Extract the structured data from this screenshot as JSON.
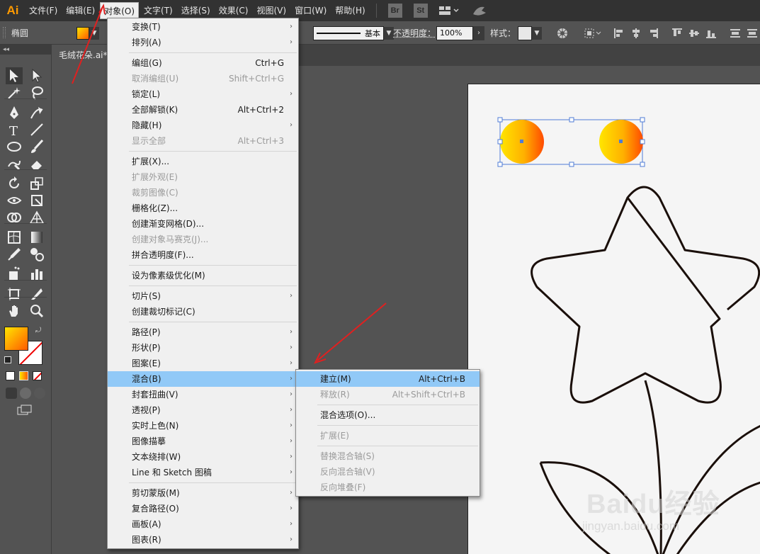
{
  "app": {
    "logo": "Ai"
  },
  "menubar": {
    "items": [
      "文件(F)",
      "编辑(E)",
      "对象(O)",
      "文字(T)",
      "选择(S)",
      "效果(C)",
      "视图(V)",
      "窗口(W)",
      "帮助(H)"
    ],
    "active_index": 2,
    "app_buttons": [
      "Br",
      "St"
    ]
  },
  "controlbar": {
    "object_type": "椭圆",
    "stroke_style": "基本",
    "opacity_label": "不透明度：",
    "opacity_value": "100%",
    "style_label": "样式："
  },
  "document": {
    "tab_title": "毛绒花朵.ai*"
  },
  "object_menu": {
    "items": [
      {
        "label": "变换(T)",
        "shortcut": "",
        "submenu": true,
        "disabled": false
      },
      {
        "label": "排列(A)",
        "shortcut": "",
        "submenu": true,
        "disabled": false
      },
      {
        "sep": true
      },
      {
        "label": "编组(G)",
        "shortcut": "Ctrl+G",
        "submenu": false,
        "disabled": false
      },
      {
        "label": "取消编组(U)",
        "shortcut": "Shift+Ctrl+G",
        "submenu": false,
        "disabled": true
      },
      {
        "label": "锁定(L)",
        "shortcut": "",
        "submenu": true,
        "disabled": false
      },
      {
        "label": "全部解锁(K)",
        "shortcut": "Alt+Ctrl+2",
        "submenu": false,
        "disabled": false
      },
      {
        "label": "隐藏(H)",
        "shortcut": "",
        "submenu": true,
        "disabled": false
      },
      {
        "label": "显示全部",
        "shortcut": "Alt+Ctrl+3",
        "submenu": false,
        "disabled": true
      },
      {
        "sep": true
      },
      {
        "label": "扩展(X)...",
        "shortcut": "",
        "submenu": false,
        "disabled": false
      },
      {
        "label": "扩展外观(E)",
        "shortcut": "",
        "submenu": false,
        "disabled": true
      },
      {
        "label": "裁剪图像(C)",
        "shortcut": "",
        "submenu": false,
        "disabled": true
      },
      {
        "label": "栅格化(Z)...",
        "shortcut": "",
        "submenu": false,
        "disabled": false
      },
      {
        "label": "创建渐变网格(D)...",
        "shortcut": "",
        "submenu": false,
        "disabled": false
      },
      {
        "label": "创建对象马赛克(J)...",
        "shortcut": "",
        "submenu": false,
        "disabled": true
      },
      {
        "label": "拼合透明度(F)...",
        "shortcut": "",
        "submenu": false,
        "disabled": false
      },
      {
        "sep": true
      },
      {
        "label": "设为像素级优化(M)",
        "shortcut": "",
        "submenu": false,
        "disabled": false
      },
      {
        "sep": true
      },
      {
        "label": "切片(S)",
        "shortcut": "",
        "submenu": true,
        "disabled": false
      },
      {
        "label": "创建裁切标记(C)",
        "shortcut": "",
        "submenu": false,
        "disabled": false
      },
      {
        "sep": true
      },
      {
        "label": "路径(P)",
        "shortcut": "",
        "submenu": true,
        "disabled": false
      },
      {
        "label": "形状(P)",
        "shortcut": "",
        "submenu": true,
        "disabled": false
      },
      {
        "label": "图案(E)",
        "shortcut": "",
        "submenu": true,
        "disabled": false
      },
      {
        "label": "混合(B)",
        "shortcut": "",
        "submenu": true,
        "disabled": false,
        "highlight": true
      },
      {
        "label": "封套扭曲(V)",
        "shortcut": "",
        "submenu": true,
        "disabled": false
      },
      {
        "label": "透视(P)",
        "shortcut": "",
        "submenu": true,
        "disabled": false
      },
      {
        "label": "实时上色(N)",
        "shortcut": "",
        "submenu": true,
        "disabled": false
      },
      {
        "label": "图像描摹",
        "shortcut": "",
        "submenu": true,
        "disabled": false
      },
      {
        "label": "文本绕排(W)",
        "shortcut": "",
        "submenu": true,
        "disabled": false
      },
      {
        "label": "Line 和 Sketch 图稿",
        "shortcut": "",
        "submenu": true,
        "disabled": false
      },
      {
        "sep": true
      },
      {
        "label": "剪切蒙版(M)",
        "shortcut": "",
        "submenu": true,
        "disabled": false
      },
      {
        "label": "复合路径(O)",
        "shortcut": "",
        "submenu": true,
        "disabled": false
      },
      {
        "label": "画板(A)",
        "shortcut": "",
        "submenu": true,
        "disabled": false
      },
      {
        "label": "图表(R)",
        "shortcut": "",
        "submenu": true,
        "disabled": false
      }
    ]
  },
  "blend_submenu": {
    "items": [
      {
        "label": "建立(M)",
        "shortcut": "Alt+Ctrl+B",
        "disabled": false,
        "highlight": true
      },
      {
        "label": "释放(R)",
        "shortcut": "Alt+Shift+Ctrl+B",
        "disabled": true
      },
      {
        "sep": true
      },
      {
        "label": "混合选项(O)...",
        "shortcut": "",
        "disabled": false
      },
      {
        "sep": true
      },
      {
        "label": "扩展(E)",
        "shortcut": "",
        "disabled": true
      },
      {
        "sep": true
      },
      {
        "label": "替换混合轴(S)",
        "shortcut": "",
        "disabled": true
      },
      {
        "label": "反向混合轴(V)",
        "shortcut": "",
        "disabled": true
      },
      {
        "label": "反向堆叠(F)",
        "shortcut": "",
        "disabled": true
      }
    ]
  },
  "colors": {
    "menubar_bg": "#323232",
    "panel_bg": "#535353",
    "menu_bg": "#f0f0f0",
    "menu_highlight": "#91c9f7",
    "gradient_start": "#ffe600",
    "gradient_end": "#ff5a00",
    "arrow": "#e02020"
  },
  "watermark": {
    "brand": "Baidu经验",
    "url": "jingyan.baidu.com"
  }
}
